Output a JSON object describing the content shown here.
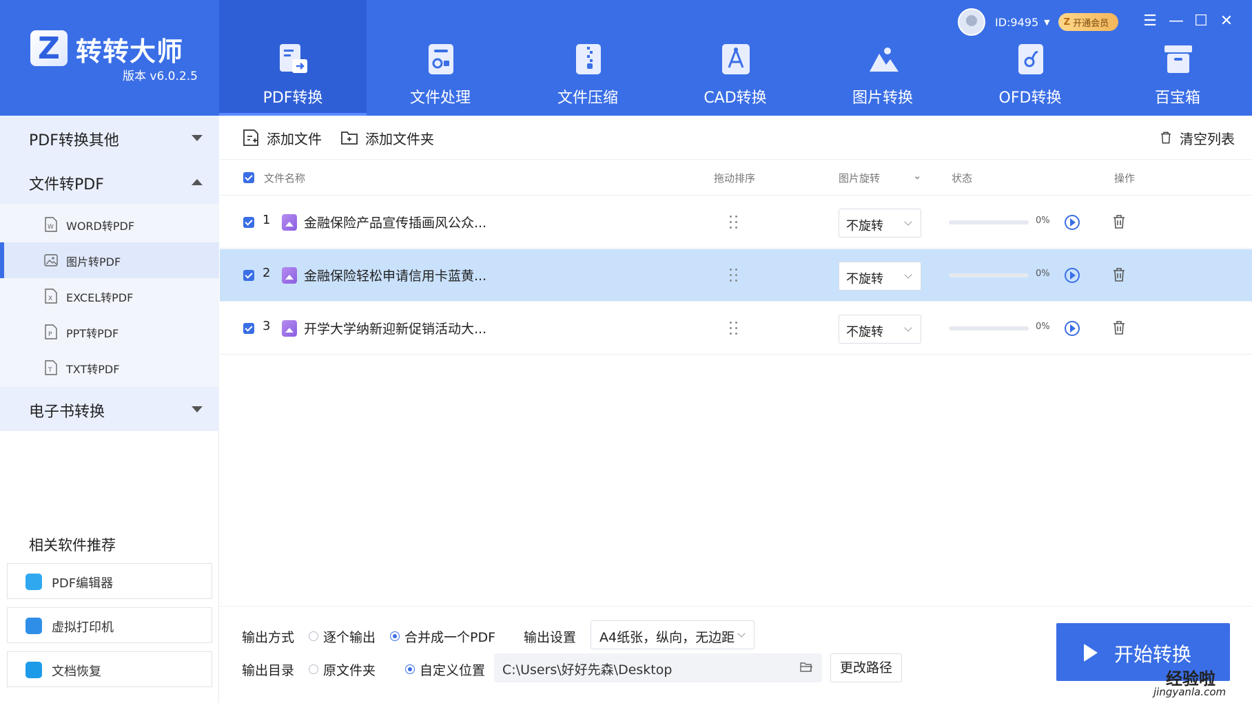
{
  "app": {
    "brand": "转转大师",
    "version": "版本 v6.0.2.5",
    "user_id": "ID:9495",
    "vip": "开通会员"
  },
  "top_tabs": [
    {
      "label": "PDF转换",
      "icon": "pdf-convert-icon",
      "active": true
    },
    {
      "label": "文件处理",
      "icon": "file-process-icon"
    },
    {
      "label": "文件压缩",
      "icon": "file-compress-icon"
    },
    {
      "label": "CAD转换",
      "icon": "cad-convert-icon"
    },
    {
      "label": "图片转换",
      "icon": "image-convert-icon"
    },
    {
      "label": "OFD转换",
      "icon": "ofd-convert-icon"
    },
    {
      "label": "百宝箱",
      "icon": "toolbox-icon"
    }
  ],
  "sidebar": {
    "groups": [
      {
        "label": "PDF转换其他",
        "expanded": false
      },
      {
        "label": "文件转PDF",
        "expanded": true
      },
      {
        "label": "电子书转换",
        "expanded": false
      }
    ],
    "sub_items": [
      {
        "label": "WORD转PDF",
        "icon": "word-file-icon"
      },
      {
        "label": "图片转PDF",
        "icon": "image-file-icon",
        "active": true
      },
      {
        "label": "EXCEL转PDF",
        "icon": "excel-file-icon"
      },
      {
        "label": "PPT转PDF",
        "icon": "ppt-file-icon"
      },
      {
        "label": "TXT转PDF",
        "icon": "txt-file-icon"
      }
    ],
    "recommend_title": "相关软件推荐",
    "recommend": [
      {
        "label": "PDF编辑器",
        "icon": "pdf-editor-icon",
        "color": "#2fa8f0"
      },
      {
        "label": "虚拟打印机",
        "icon": "virtual-printer-icon",
        "color": "#2f8fe8"
      },
      {
        "label": "文档恢复",
        "icon": "doc-recovery-icon",
        "color": "#1e9be8"
      }
    ]
  },
  "toolbar": {
    "add_file": "添加文件",
    "add_folder": "添加文件夹",
    "clear_list": "清空列表"
  },
  "table": {
    "headers": {
      "name": "文件名称",
      "drag": "拖动排序",
      "rotate": "图片旋转",
      "status": "状态",
      "action": "操作"
    },
    "rows": [
      {
        "index": "1",
        "name": "金融保险产品宣传插画风公众...",
        "rotate": "不旋转",
        "progress": 0,
        "pct": "0%",
        "selected": false
      },
      {
        "index": "2",
        "name": "金融保险轻松申请信用卡蓝黄...",
        "rotate": "不旋转",
        "progress": 0,
        "pct": "0%",
        "selected": true
      },
      {
        "index": "3",
        "name": "开学大学纳新迎新促销活动大...",
        "rotate": "不旋转",
        "progress": 0,
        "pct": "0%",
        "selected": false
      }
    ]
  },
  "output": {
    "mode_label": "输出方式",
    "mode_options": [
      "逐个输出",
      "合并成一个PDF"
    ],
    "mode_selected": "合并成一个PDF",
    "settings_label": "输出设置",
    "settings_value": "A4纸张，纵向，无边距",
    "dir_label": "输出目录",
    "dir_options": [
      "原文件夹",
      "自定义位置"
    ],
    "dir_selected": "自定义位置",
    "path": "C:\\Users\\好好先森\\Desktop",
    "change_path": "更改路径",
    "start": "开始转换"
  },
  "watermark": {
    "line1": "经验啦",
    "line2": "jingyanla.com"
  },
  "colors": {
    "brand_blue": "#3a6ee6",
    "selected_row": "#c9e1fb"
  }
}
